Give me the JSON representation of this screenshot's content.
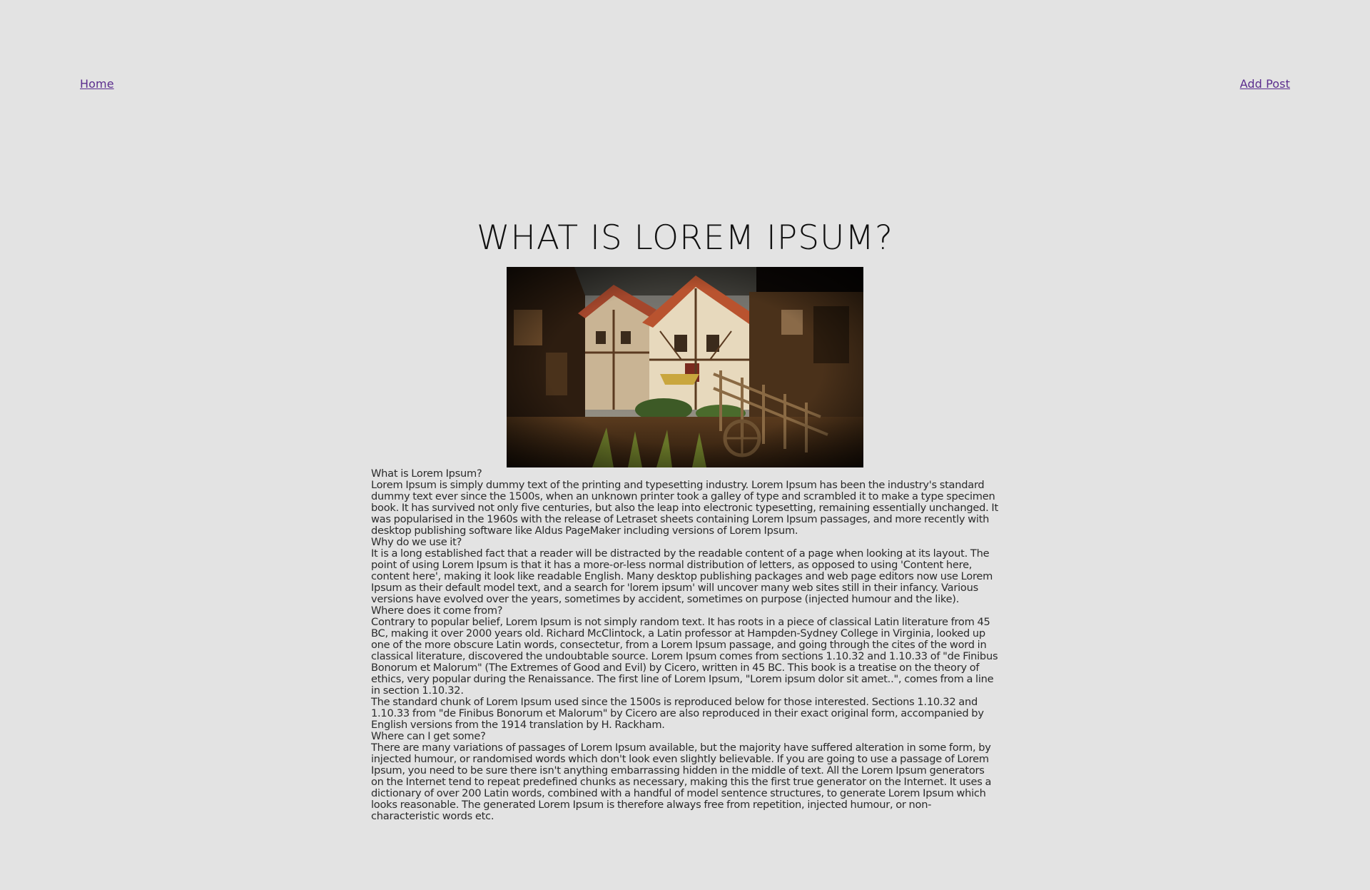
{
  "nav": {
    "home_label": "Home",
    "add_post_label": "Add Post"
  },
  "colors": {
    "background": "#e3e3e3",
    "link": "#5b2d8e",
    "text": "#222222"
  },
  "post": {
    "title": "WHAT IS LOREM IPSUM?",
    "image_alt": "medieval-village-street",
    "lines": [
      "What is Lorem Ipsum?",
      "Lorem Ipsum is simply dummy text of the printing and typesetting industry. Lorem Ipsum has been the industry's standard dummy text ever since the 1500s, when an unknown printer took a galley of type and scrambled it to make a type specimen book. It has survived not only five centuries, but also the leap into electronic typesetting, remaining essentially unchanged. It was popularised in the 1960s with the release of Letraset sheets containing Lorem Ipsum passages, and more recently with desktop publishing software like Aldus PageMaker including versions of Lorem Ipsum.",
      "Why do we use it?",
      "It is a long established fact that a reader will be distracted by the readable content of a page when looking at its layout. The point of using Lorem Ipsum is that it has a more-or-less normal distribution of letters, as opposed to using 'Content here, content here', making it look like readable English. Many desktop publishing packages and web page editors now use Lorem Ipsum as their default model text, and a search for 'lorem ipsum' will uncover many web sites still in their infancy. Various versions have evolved over the years, sometimes by accident, sometimes on purpose (injected humour and the like).",
      "Where does it come from?",
      "Contrary to popular belief, Lorem Ipsum is not simply random text. It has roots in a piece of classical Latin literature from 45 BC, making it over 2000 years old. Richard McClintock, a Latin professor at Hampden-Sydney College in Virginia, looked up one of the more obscure Latin words, consectetur, from a Lorem Ipsum passage, and going through the cites of the word in classical literature, discovered the undoubtable source. Lorem Ipsum comes from sections 1.10.32 and 1.10.33 of \"de Finibus Bonorum et Malorum\" (The Extremes of Good and Evil) by Cicero, written in 45 BC. This book is a treatise on the theory of ethics, very popular during the Renaissance. The first line of Lorem Ipsum, \"Lorem ipsum dolor sit amet..\", comes from a line in section 1.10.32.",
      "The standard chunk of Lorem Ipsum used since the 1500s is reproduced below for those interested. Sections 1.10.32 and 1.10.33 from \"de Finibus Bonorum et Malorum\" by Cicero are also reproduced in their exact original form, accompanied by English versions from the 1914 translation by H. Rackham.",
      "Where can I get some?",
      "There are many variations of passages of Lorem Ipsum available, but the majority have suffered alteration in some form, by injected humour, or randomised words which don't look even slightly believable. If you are going to use a passage of Lorem Ipsum, you need to be sure there isn't anything embarrassing hidden in the middle of text. All the Lorem Ipsum generators on the Internet tend to repeat predefined chunks as necessary, making this the first true generator on the Internet. It uses a dictionary of over 200 Latin words, combined with a handful of model sentence structures, to generate Lorem Ipsum which looks reasonable. The generated Lorem Ipsum is therefore always free from repetition, injected humour, or non-characteristic words etc."
    ]
  }
}
